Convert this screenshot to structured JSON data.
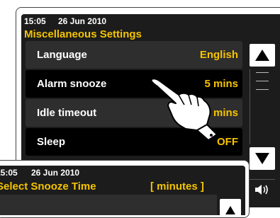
{
  "main_screen": {
    "status": {
      "time": "15:05",
      "date": "26 Jun 2010"
    },
    "title": "Miscellaneous Settings",
    "items": [
      {
        "label": "Language",
        "value": "English"
      },
      {
        "label": "Alarm snooze",
        "value": "5 mins"
      },
      {
        "label": "Idle timeout",
        "value": "5 mins"
      },
      {
        "label": "Sleep",
        "value": "OFF"
      }
    ]
  },
  "popup_screen": {
    "status": {
      "time": "15:05",
      "date": "26 Jun 2010"
    },
    "title": "Select Snooze Time",
    "title_unit": "[ minutes ]"
  },
  "icons": {
    "scroll_up": "triangle-up-icon",
    "scroll_down": "triangle-down-icon",
    "volume": "speaker-icon",
    "pointer": "pointing-hand-icon"
  },
  "colors": {
    "screen_bg": "#1c1c1c",
    "accent_yellow": "#f5c400",
    "row_light": "#2e2e2e",
    "row_dark": "#000000",
    "text": "#ffffff"
  }
}
